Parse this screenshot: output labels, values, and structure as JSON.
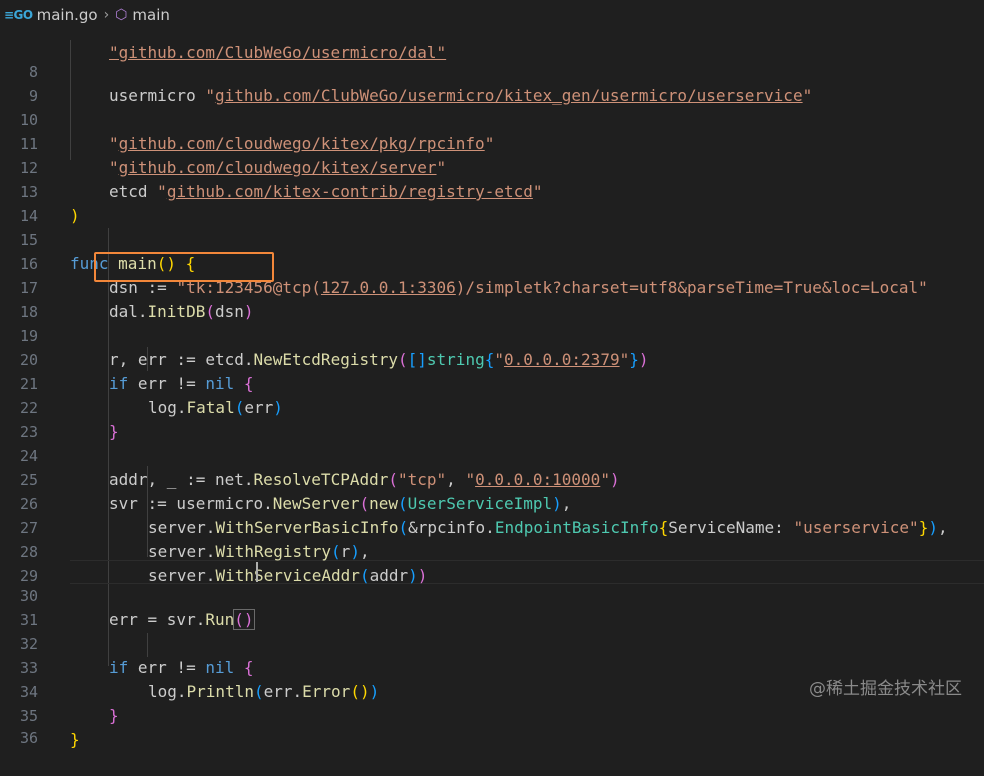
{
  "breadcrumb": {
    "file_icon": "go-file-icon",
    "file_icon_text": "≡GO",
    "file_name": "main.go",
    "separator": "›",
    "symbol_icon": "cube-icon",
    "symbol_name": "main"
  },
  "editor": {
    "lines": [
      {
        "n": "8",
        "c": "usermicro \"github.com/ClubWeGo/usermicro/kitex_gen/usermicro/userservice\""
      },
      {
        "n": "9",
        "c": ""
      },
      {
        "n": "10",
        "c": "\"github.com/cloudwego/kitex/pkg/rpcinfo\""
      },
      {
        "n": "11",
        "c": "\"github.com/cloudwego/kitex/server\""
      },
      {
        "n": "12",
        "c": "etcd \"github.com/kitex-contrib/registry-etcd\""
      },
      {
        "n": "13",
        "c": ")"
      },
      {
        "n": "14",
        "c": ""
      },
      {
        "n": "15",
        "c": "func main() {"
      },
      {
        "n": "16",
        "c": "dsn := \"tk:123456@tcp(127.0.0.1:3306)/simpletk?charset=utf8&parseTime=True&loc=Local\""
      },
      {
        "n": "17",
        "c": "dal.InitDB(dsn)"
      },
      {
        "n": "18",
        "c": ""
      },
      {
        "n": "19",
        "c": "r, err := etcd.NewEtcdRegistry([]string{\"0.0.0.0:2379\"})"
      },
      {
        "n": "20",
        "c": "if err != nil {"
      },
      {
        "n": "21",
        "c": "log.Fatal(err)"
      },
      {
        "n": "22",
        "c": "}"
      },
      {
        "n": "23",
        "c": ""
      },
      {
        "n": "24",
        "c": "addr, _ := net.ResolveTCPAddr(\"tcp\", \"0.0.0.0:10000\")"
      },
      {
        "n": "25",
        "c": "svr := usermicro.NewServer(new(UserServiceImpl),"
      },
      {
        "n": "26",
        "c": "server.WithServerBasicInfo(&rpcinfo.EndpointBasicInfo{ServiceName: \"userservice\"}),"
      },
      {
        "n": "27",
        "c": "server.WithRegistry(r),"
      },
      {
        "n": "28",
        "c": "server.WithServiceAddr(addr))"
      },
      {
        "n": "29",
        "c": ""
      },
      {
        "n": "30",
        "c": "err = svr.Run()"
      },
      {
        "n": "31",
        "c": ""
      },
      {
        "n": "32",
        "c": "if err != nil {"
      },
      {
        "n": "33",
        "c": "log.Println(err.Error())"
      },
      {
        "n": "34",
        "c": "}"
      },
      {
        "n": "35",
        "c": "}"
      },
      {
        "n": "36",
        "c": ""
      }
    ],
    "partial_top_line": "\"github.com/ClubWeGo/usermicro/dal\""
  },
  "watermark": "@稀土掘金技术社区",
  "colors": {
    "background": "#1f1f1f",
    "keyword": "#569cd6",
    "string": "#ce9178",
    "function": "#dcdcaa",
    "type": "#4ec9b0",
    "highlight_box": "#f2873a",
    "line_number": "#6e7681"
  }
}
